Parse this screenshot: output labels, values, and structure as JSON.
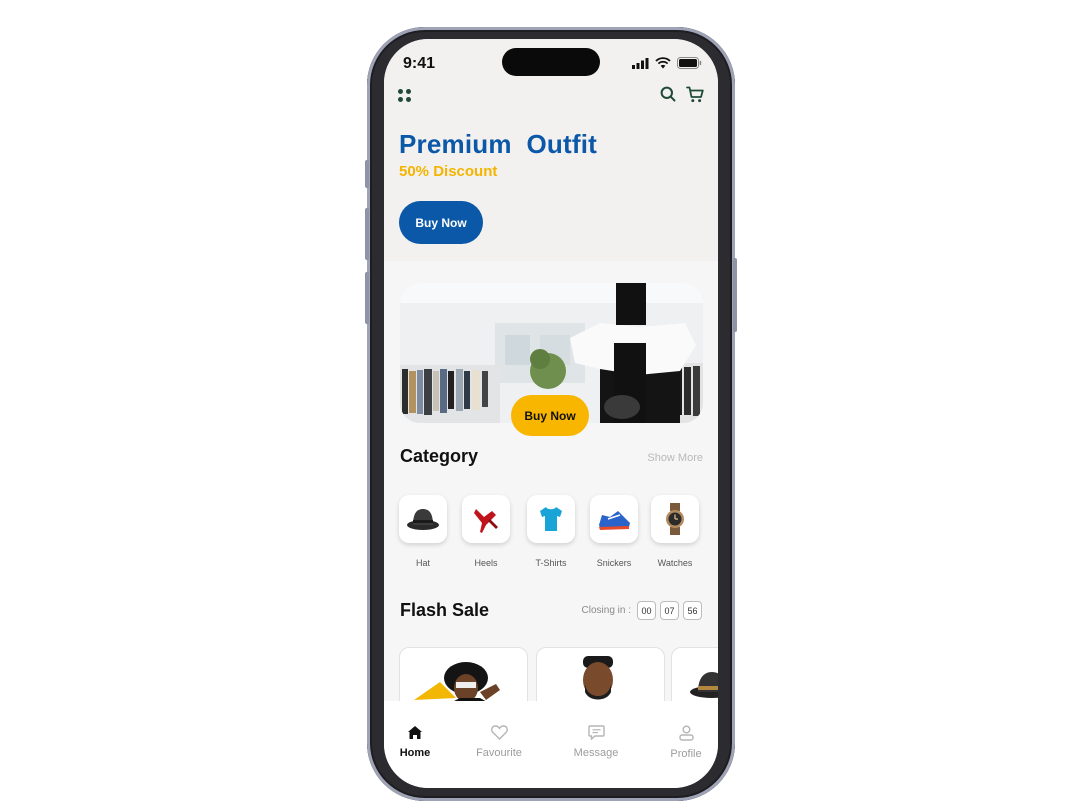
{
  "status_bar": {
    "time": "9:41"
  },
  "hero": {
    "title": "Premium  Outfit",
    "subtitle": "50% Discount",
    "button_label": "Buy Now"
  },
  "banner": {
    "button_label": "Buy Now"
  },
  "category": {
    "title": "Category",
    "show_more": "Show More",
    "items": [
      {
        "label": "Hat",
        "icon": "hat-icon"
      },
      {
        "label": "Heels",
        "icon": "heels-icon"
      },
      {
        "label": "T-Shirts",
        "icon": "tshirt-icon"
      },
      {
        "label": "Snickers",
        "icon": "sneaker-icon"
      },
      {
        "label": "Watches",
        "icon": "watch-icon"
      }
    ]
  },
  "flash_sale": {
    "title": "Flash Sale",
    "closing_label": "Closing in :",
    "timer": [
      "00",
      "07",
      "56"
    ]
  },
  "tabbar": {
    "items": [
      {
        "label": "Home",
        "icon": "home-icon",
        "active": true
      },
      {
        "label": "Favourite",
        "icon": "heart-icon",
        "active": false
      },
      {
        "label": "Message",
        "icon": "message-icon",
        "active": false
      },
      {
        "label": "Profile",
        "icon": "profile-icon",
        "active": false
      }
    ]
  },
  "colors": {
    "primary": "#0b57a8",
    "accent": "#f9b600",
    "menu_icon": "#1f4b35"
  }
}
